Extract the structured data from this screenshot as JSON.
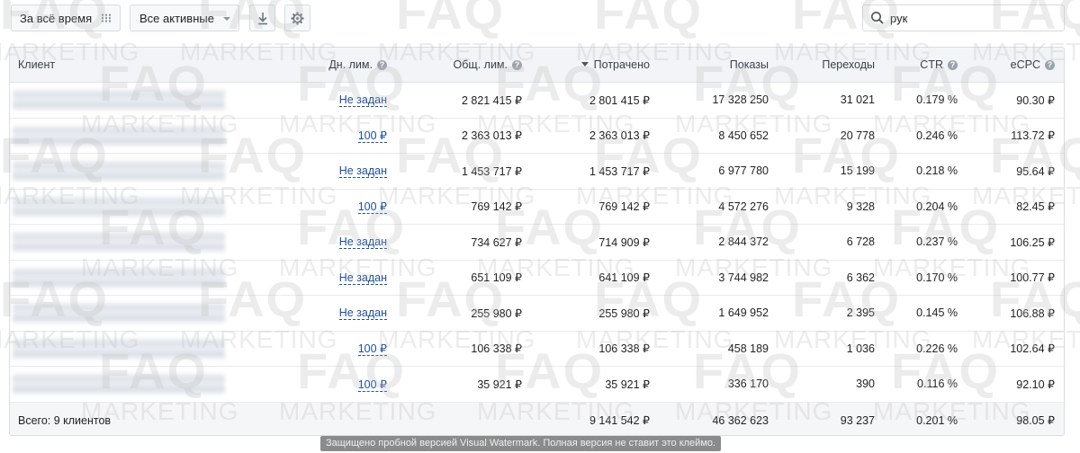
{
  "toolbar": {
    "period_label": "За всё время",
    "status_label": "Все активные",
    "search_value": "рук"
  },
  "columns": {
    "client": "Клиент",
    "daily_limit": "Дн. лим.",
    "total_limit": "Общ. лим.",
    "spent": "Потрачено",
    "impressions": "Показы",
    "clicks": "Переходы",
    "ctr": "CTR",
    "ecpc": "eCPC"
  },
  "rows": [
    {
      "daily_limit": "Не задан",
      "total_limit": "2 821 415 ₽",
      "spent": "2 801 415 ₽",
      "impressions": "17 328 250",
      "clicks": "31 021",
      "ctr": "0.179 %",
      "ecpc": "90.30 ₽"
    },
    {
      "daily_limit": "100 ₽",
      "total_limit": "2 363 013 ₽",
      "spent": "2 363 013 ₽",
      "impressions": "8 450 652",
      "clicks": "20 778",
      "ctr": "0.246 %",
      "ecpc": "113.72 ₽"
    },
    {
      "daily_limit": "Не задан",
      "total_limit": "1 453 717 ₽",
      "spent": "1 453 717 ₽",
      "impressions": "6 977 780",
      "clicks": "15 199",
      "ctr": "0.218 %",
      "ecpc": "95.64 ₽"
    },
    {
      "daily_limit": "100 ₽",
      "total_limit": "769 142 ₽",
      "spent": "769 142 ₽",
      "impressions": "4 572 276",
      "clicks": "9 328",
      "ctr": "0.204 %",
      "ecpc": "82.45 ₽"
    },
    {
      "daily_limit": "Не задан",
      "total_limit": "734 627 ₽",
      "spent": "714 909 ₽",
      "impressions": "2 844 372",
      "clicks": "6 728",
      "ctr": "0.237 %",
      "ecpc": "106.25 ₽"
    },
    {
      "daily_limit": "Не задан",
      "total_limit": "651 109 ₽",
      "spent": "641 109 ₽",
      "impressions": "3 744 982",
      "clicks": "6 362",
      "ctr": "0.170 %",
      "ecpc": "100.77 ₽"
    },
    {
      "daily_limit": "Не задан",
      "total_limit": "255 980 ₽",
      "spent": "255 980 ₽",
      "impressions": "1 649 952",
      "clicks": "2 395",
      "ctr": "0.145 %",
      "ecpc": "106.88 ₽"
    },
    {
      "daily_limit": "100 ₽",
      "total_limit": "106 338 ₽",
      "spent": "106 338 ₽",
      "impressions": "458 189",
      "clicks": "1 036",
      "ctr": "0.226 %",
      "ecpc": "102.64 ₽"
    },
    {
      "daily_limit": "100 ₽",
      "total_limit": "35 921 ₽",
      "spent": "35 921 ₽",
      "impressions": "336 170",
      "clicks": "390",
      "ctr": "0.116 %",
      "ecpc": "92.10 ₽"
    }
  ],
  "totals": {
    "label": "Всего: 9 клиентов",
    "spent": "9 141 542 ₽",
    "impressions": "46 362 623",
    "clicks": "93 237",
    "ctr": "0.201 %",
    "ecpc": "98.05 ₽"
  },
  "watermark": {
    "brand": "FAQ",
    "sub": "MARKETING",
    "trial_notice": "Защищено пробной версией Visual Watermark. Полная версия не ставит это клеймо."
  },
  "icons": {
    "period": "grid-dots-icon",
    "status": "chevron-down-icon",
    "download": "download-icon",
    "settings": "gear-icon",
    "search": "search-icon",
    "help": "help-circle-icon",
    "sort": "sort-desc-icon"
  },
  "colors": {
    "link": "#1f4e9b",
    "header_bg": "#f2f4f7",
    "help_icon": "#9aa3ad"
  }
}
